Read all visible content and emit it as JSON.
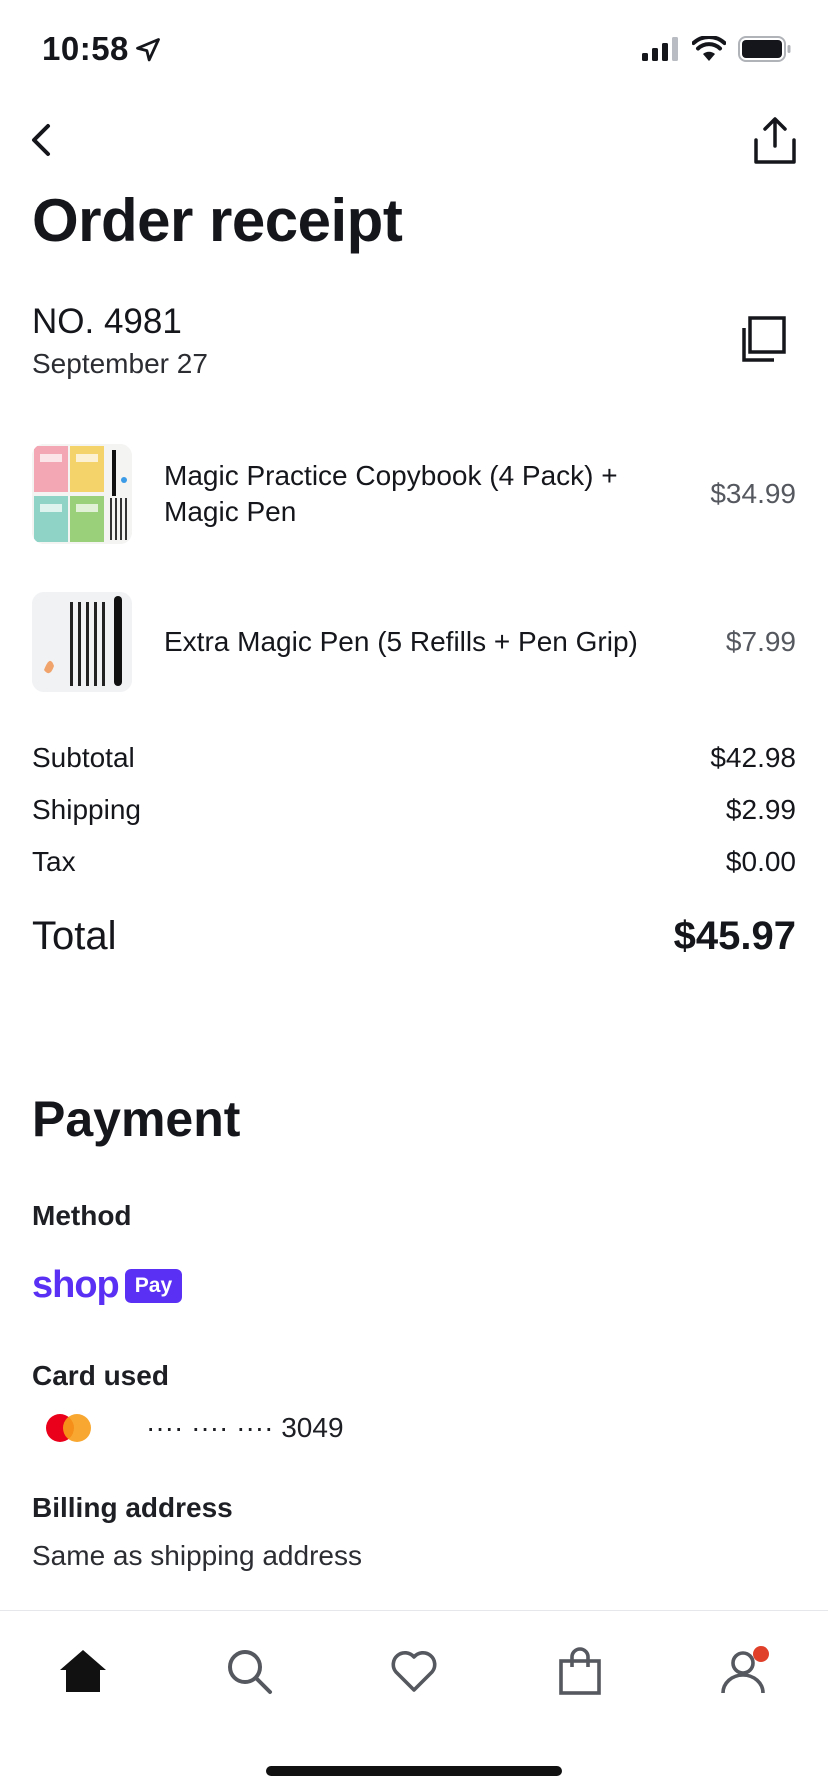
{
  "status": {
    "time": "10:58"
  },
  "header": {
    "title": "Order receipt"
  },
  "order": {
    "number": "NO. 4981",
    "date": "September 27"
  },
  "items": [
    {
      "name": "Magic Practice Copybook (4 Pack) + Magic Pen",
      "price": "$34.99"
    },
    {
      "name": "Extra Magic Pen (5 Refills + Pen Grip)",
      "price": "$7.99"
    }
  ],
  "summary": {
    "subtotal_label": "Subtotal",
    "subtotal": "$42.98",
    "shipping_label": "Shipping",
    "shipping": "$2.99",
    "tax_label": "Tax",
    "tax": "$0.00",
    "total_label": "Total",
    "total": "$45.97"
  },
  "payment": {
    "title": "Payment",
    "method_label": "Method",
    "method_brand": "shop",
    "method_pill": "Pay",
    "card_label": "Card used",
    "card_number": "···· ···· ···· 3049",
    "billing_label": "Billing address",
    "billing_value": "Same as shipping address"
  },
  "icons": {
    "back": "chevron-left-icon",
    "share": "share-icon",
    "copy": "copy-icon",
    "tabs": [
      "home-icon",
      "search-icon",
      "heart-icon",
      "bag-icon",
      "profile-icon"
    ]
  },
  "colors": {
    "shop_pay": "#5a31f4",
    "notification_dot": "#e0402a",
    "text": "#14161c"
  }
}
